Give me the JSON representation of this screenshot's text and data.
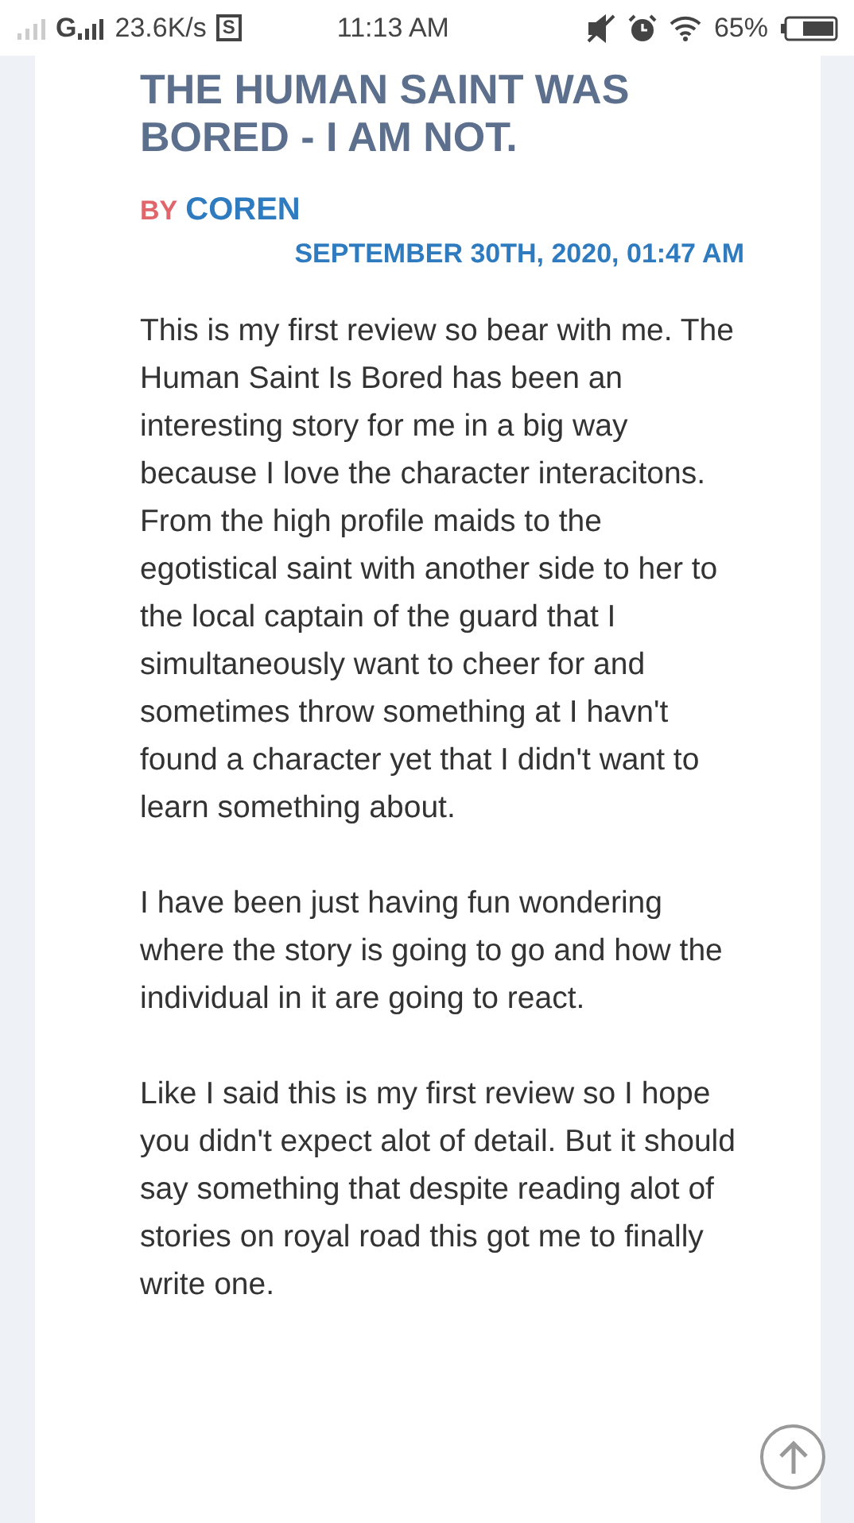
{
  "status_bar": {
    "network_label": "G",
    "speed": "23.6K/s",
    "sim_badge": "S",
    "time": "11:13 AM",
    "battery": "65%"
  },
  "review": {
    "title": "THE HUMAN SAINT WAS BORED - I AM NOT.",
    "by_label": "BY",
    "author": "COREN",
    "date": "SEPTEMBER 30TH, 2020, 01:47 AM",
    "paragraphs": [
      "This is my first review so bear with me. The Human Saint Is Bored has been an interesting story for me in a big way because I love the character interacitons. From the high profile maids to the egotistical saint with another side to her to the local captain of the guard that I simultaneously want to cheer for and sometimes throw something at I havn't found a character yet that I didn't want to learn something about.",
      "I have been just having fun wondering where the story is going to go and how the individual in it are going to react.",
      "Like I said this is my first review so I hope you didn't expect alot of detail. But it should say something that despite reading alot of stories on royal road this got me to finally write one."
    ]
  }
}
